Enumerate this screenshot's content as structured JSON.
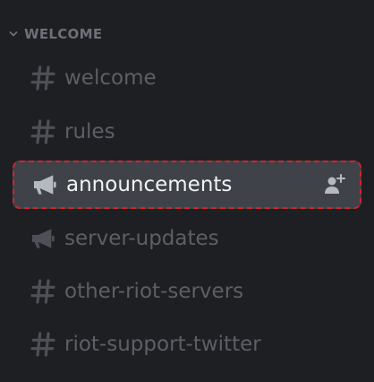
{
  "category": {
    "label": "WELCOME",
    "chevron_icon": "chevron-down-icon"
  },
  "channels": [
    {
      "name": "welcome",
      "type": "text",
      "icon": "hash-icon",
      "selected": false
    },
    {
      "name": "rules",
      "type": "text",
      "icon": "hash-icon",
      "selected": false
    },
    {
      "name": "announcements",
      "type": "announcement",
      "icon": "megaphone-icon",
      "selected": true,
      "action_icon": "invite-member-icon"
    },
    {
      "name": "server-updates",
      "type": "announcement",
      "icon": "megaphone-icon",
      "selected": false
    },
    {
      "name": "other-riot-servers",
      "type": "text",
      "icon": "hash-icon",
      "selected": false
    },
    {
      "name": "riot-support-twitter",
      "type": "text",
      "icon": "hash-icon",
      "selected": false
    }
  ],
  "colors": {
    "background": "#1e1f22",
    "selected_background": "#404249",
    "selected_outline": "#d4232b",
    "muted_text": "#5c5f66",
    "selected_text": "#f2f3f5"
  }
}
